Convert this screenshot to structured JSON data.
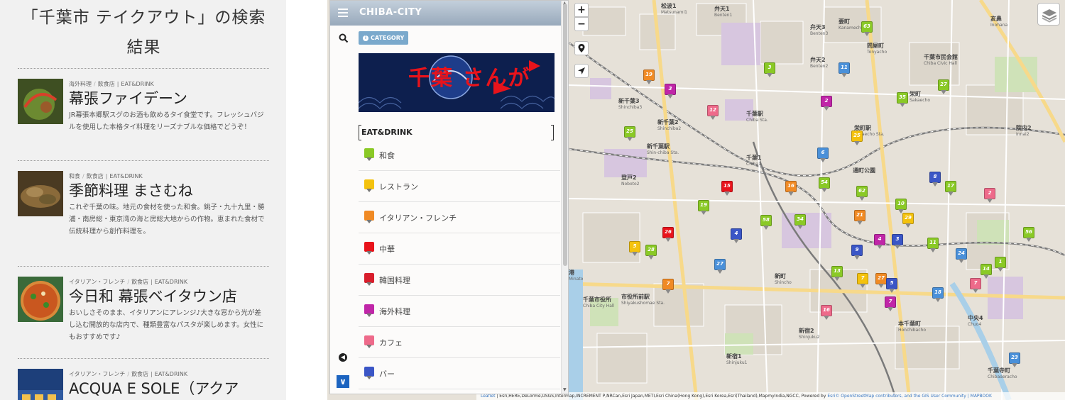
{
  "results": {
    "title": "「千葉市 テイクアウト」の検索結果",
    "items": [
      {
        "cat1": "海外料理",
        "cat2": "飲食店",
        "cat3": "EAT&DRINK",
        "name": "幕張ファイデーン",
        "desc": "JR幕張本郷駅スグのお酒も飲めるタイ食堂です。フレッシュバジルを使用した本格タイ料理をリーズナブルな価格でどうぞ！"
      },
      {
        "cat1": "和食",
        "cat2": "飲食店",
        "cat3": "EAT&DRINK",
        "name": "季節料理 まさむね",
        "desc": "これぞ千葉の味。地元の食材を使った和食。銚子・九十九里・勝浦・南房総・東京湾の海と房総大地からの作物。恵まれた食材で伝統料理から創作料理を。"
      },
      {
        "cat1": "イタリアン・フレンチ",
        "cat2": "飲食店",
        "cat3": "EAT&DRINK",
        "name": "今日和 幕張ベイタウン店",
        "desc": "おいしさそのまま、イタリアンにアレンジ♪大きな窓から光が差し込む開放的な店内で、種類豊富なパスタが楽しめます。女性にもおすすめです♪"
      },
      {
        "cat1": "イタリアン・フレンチ",
        "cat2": "飲食店",
        "cat3": "EAT&DRINK",
        "name": "ACQUA E SOLE（アクア",
        "desc": ""
      }
    ]
  },
  "panel": {
    "title": "CHIBA-CITY",
    "category_chip": "CATEGORY",
    "banner_text": "千葉 さんが",
    "section_label": "EAT&DRINK",
    "categories": [
      {
        "label": "和食",
        "color": "#8ac926"
      },
      {
        "label": "レストラン",
        "color": "#f4c20d"
      },
      {
        "label": "イタリアン・フレンチ",
        "color": "#f08a24"
      },
      {
        "label": "中華",
        "color": "#e8131b"
      },
      {
        "label": "韓国料理",
        "color": "#d81e2c"
      },
      {
        "label": "海外料理",
        "color": "#c026a8"
      },
      {
        "label": "カフェ",
        "color": "#ee6a8a"
      },
      {
        "label": "バー",
        "color": "#3b56c6"
      }
    ]
  },
  "map": {
    "zoom_in": "+",
    "zoom_out": "−",
    "attribution_leaflet": "Leaflet",
    "attribution_text": " | Esri,HERE,DeLorme,USGS,Intermap,INCREMENT P,NRCan,Esri Japan,METI,Esri China(Hong Kong),Esri Korea,Esri(Thailand),MapmyIndia,NGCC, Powered by ",
    "attribution_esri": "Esri",
    "attribution_osm": "© OpenStreetMap contributors, and the GIS User Community",
    "attribution_mapbook": " | MAPBOOK",
    "labels": [
      {
        "jp": "松波1",
        "en": "Matsunami1"
      },
      {
        "jp": "弁天1",
        "en": "Benten1"
      },
      {
        "jp": "弁天2",
        "en": "Benten2"
      },
      {
        "jp": "弁天3",
        "en": "Benten3"
      },
      {
        "jp": "新千葉3",
        "en": "Shinchiba3"
      },
      {
        "jp": "新千葉2",
        "en": "Shinchiba2"
      },
      {
        "jp": "新千葉駅",
        "en": "Shin-chiba Sta."
      },
      {
        "jp": "千葉駅",
        "en": "Chiba Sta."
      },
      {
        "jp": "千葉1",
        "en": "Chiba1"
      },
      {
        "jp": "登戸2",
        "en": "Noboto2"
      },
      {
        "jp": "栄町駅",
        "en": "Sakaecho Sta."
      },
      {
        "jp": "栄町",
        "en": "Sakaecho"
      },
      {
        "jp": "院内2",
        "en": "Innai2"
      },
      {
        "jp": "港",
        "en": "Minato"
      },
      {
        "jp": "千葉市役所",
        "en": "Chiba City Hall"
      },
      {
        "jp": "市役所前駅",
        "en": "Shiyakushomae Sta."
      },
      {
        "jp": "新町",
        "en": "Shincho"
      },
      {
        "jp": "新宿2",
        "en": "Shinjuku2"
      },
      {
        "jp": "新宿1",
        "en": "Shinjuku1"
      },
      {
        "jp": "本千葉町",
        "en": "Honchibacho"
      },
      {
        "jp": "中央4",
        "en": "Chuo4"
      },
      {
        "jp": "千葉寺町",
        "en": "Chibaderacho"
      },
      {
        "jp": "要町",
        "en": "Kanamecho"
      },
      {
        "jp": "問屋町",
        "en": "Tonyacho"
      },
      {
        "jp": "通町公園",
        "en": ""
      },
      {
        "jp": "千葉市民会館",
        "en": "Chiba Civic Hall"
      },
      {
        "jp": "亥鼻",
        "en": "Inohana"
      }
    ],
    "pins": [
      {
        "n": "19",
        "c": "#f08a24"
      },
      {
        "n": "3",
        "c": "#c026a8"
      },
      {
        "n": "3",
        "c": "#8ac926"
      },
      {
        "n": "63",
        "c": "#8ac926"
      },
      {
        "n": "11",
        "c": "#4a90d9"
      },
      {
        "n": "2",
        "c": "#c026a8"
      },
      {
        "n": "25",
        "c": "#8ac926"
      },
      {
        "n": "12",
        "c": "#ee6a8a"
      },
      {
        "n": "25",
        "c": "#f4c20d"
      },
      {
        "n": "35",
        "c": "#8ac926"
      },
      {
        "n": "27",
        "c": "#8ac926"
      },
      {
        "n": "6",
        "c": "#4a90d9"
      },
      {
        "n": "15",
        "c": "#e8131b"
      },
      {
        "n": "16",
        "c": "#f08a24"
      },
      {
        "n": "54",
        "c": "#8ac926"
      },
      {
        "n": "8",
        "c": "#3b56c6"
      },
      {
        "n": "17",
        "c": "#8ac926"
      },
      {
        "n": "2",
        "c": "#ee6a8a"
      },
      {
        "n": "19",
        "c": "#8ac926"
      },
      {
        "n": "4",
        "c": "#3b56c6"
      },
      {
        "n": "58",
        "c": "#8ac926"
      },
      {
        "n": "34",
        "c": "#8ac926"
      },
      {
        "n": "21",
        "c": "#f08a24"
      },
      {
        "n": "29",
        "c": "#f4c20d"
      },
      {
        "n": "5",
        "c": "#f4c20d"
      },
      {
        "n": "28",
        "c": "#8ac926"
      },
      {
        "n": "26",
        "c": "#e8131b"
      },
      {
        "n": "27",
        "c": "#4a90d9"
      },
      {
        "n": "9",
        "c": "#3b56c6"
      },
      {
        "n": "4",
        "c": "#c026a8"
      },
      {
        "n": "3",
        "c": "#3b56c6"
      },
      {
        "n": "11",
        "c": "#8ac926"
      },
      {
        "n": "24",
        "c": "#4a90d9"
      },
      {
        "n": "14",
        "c": "#8ac926"
      },
      {
        "n": "7",
        "c": "#f08a24"
      },
      {
        "n": "13",
        "c": "#8ac926"
      },
      {
        "n": "7",
        "c": "#f4c20d"
      },
      {
        "n": "27",
        "c": "#f08a24"
      },
      {
        "n": "5",
        "c": "#3b56c6"
      },
      {
        "n": "18",
        "c": "#4a90d9"
      },
      {
        "n": "7",
        "c": "#ee6a8a"
      },
      {
        "n": "16",
        "c": "#ee6a8a"
      },
      {
        "n": "7",
        "c": "#c026a8"
      },
      {
        "n": "23",
        "c": "#4a90d9"
      },
      {
        "n": "1",
        "c": "#8ac926"
      },
      {
        "n": "62",
        "c": "#8ac926"
      },
      {
        "n": "56",
        "c": "#8ac926"
      },
      {
        "n": "10",
        "c": "#8ac926"
      }
    ]
  },
  "thumbs": {
    "t1": "#5e7d2c",
    "t2": "#8a6a3a",
    "t3": "#c9571f",
    "t4": "#2f5aa0"
  }
}
